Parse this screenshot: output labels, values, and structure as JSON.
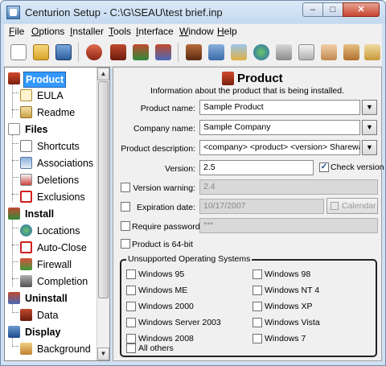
{
  "window": {
    "title": "Centurion Setup - C:\\G\\SEAU\\test brief.inp",
    "close_glyph": "✕",
    "max_glyph": "□",
    "min_glyph": "–"
  },
  "menu": [
    "File",
    "Options",
    "Installer",
    "Tools",
    "Interface",
    "Window",
    "Help"
  ],
  "toolbar": {
    "icons": [
      "new-icon",
      "open-icon",
      "save-icon",
      "build-icon",
      "build-run-icon",
      "build-test-icon",
      "build-options-icon",
      "compile-icon",
      "save-package-icon",
      "publish-icon",
      "web-icon",
      "lock-icon",
      "copy-icon",
      "handshake-icon",
      "tools-icon",
      "script-icon"
    ]
  },
  "tree": {
    "items": [
      {
        "label": "Product",
        "icon": "product-icon",
        "level": 0,
        "selected": true
      },
      {
        "label": "EULA",
        "icon": "eula-icon",
        "level": 1
      },
      {
        "label": "Readme",
        "icon": "readme-icon",
        "level": 1
      },
      {
        "label": "Files",
        "icon": "files-icon",
        "level": 0
      },
      {
        "label": "Shortcuts",
        "icon": "shortcuts-icon",
        "level": 1
      },
      {
        "label": "Associations",
        "icon": "associations-icon",
        "level": 1
      },
      {
        "label": "Deletions",
        "icon": "deletions-icon",
        "level": 1
      },
      {
        "label": "Exclusions",
        "icon": "exclusions-icon",
        "level": 1
      },
      {
        "label": "Install",
        "icon": "install-icon",
        "level": 0
      },
      {
        "label": "Locations",
        "icon": "locations-icon",
        "level": 1
      },
      {
        "label": "Auto-Close",
        "icon": "auto-close-icon",
        "level": 1
      },
      {
        "label": "Firewall",
        "icon": "firewall-icon",
        "level": 1
      },
      {
        "label": "Completion",
        "icon": "completion-icon",
        "level": 1
      },
      {
        "label": "Uninstall",
        "icon": "uninstall-icon",
        "level": 0
      },
      {
        "label": "Data",
        "icon": "data-icon",
        "level": 1
      },
      {
        "label": "Display",
        "icon": "display-icon",
        "level": 0
      },
      {
        "label": "Background",
        "icon": "background-icon",
        "level": 1
      }
    ]
  },
  "panel": {
    "title": "Product",
    "subtitle": "Information about the product that is being installed.",
    "product_name_label": "Product name:",
    "product_name_value": "Sample Product",
    "company_name_label": "Company name:",
    "company_name_value": "Sample Company",
    "description_label": "Product description:",
    "description_value": "<company> <product> <version> Shareware Ec",
    "version_label": "Version:",
    "version_value": "2.5",
    "check_version_label": "Check version",
    "check_version_checked": true,
    "version_warning_label": "Version warning:",
    "version_warning_value": "2.4",
    "expiration_label": "Expiration date:",
    "expiration_value": "10/17/2007",
    "calendar_label": "Calendar",
    "require_password_label": "Require password:",
    "password_value": "***",
    "is64_label": "Product is 64-bit",
    "dropdown_glyph": "▼",
    "check_glyph": "✓"
  },
  "os_group": {
    "title": "Unsupported Operating Systems",
    "left": [
      "Windows 95",
      "Windows ME",
      "Windows 2000",
      "Windows Server 2003",
      "Windows 2008",
      "All others"
    ],
    "right": [
      "Windows 98",
      "Windows NT 4",
      "Windows XP",
      "Windows Vista",
      "Windows 7"
    ]
  },
  "colors": {
    "selection": "#3399ff",
    "window_frame": "#cfe0f2",
    "close_button": "#c7452f"
  }
}
